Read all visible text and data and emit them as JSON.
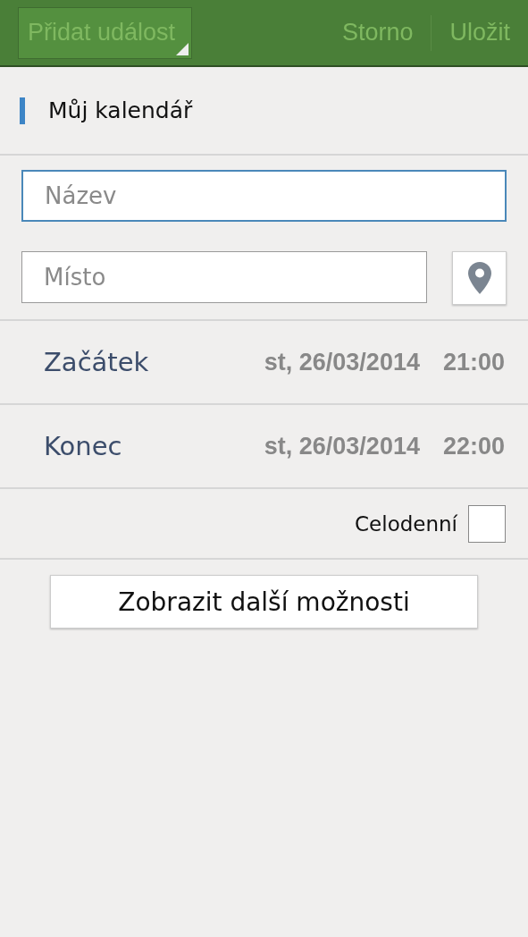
{
  "toolbar": {
    "title": "Přidat událost",
    "actions": [
      "Storno",
      "Uložit"
    ]
  },
  "calendar": {
    "name": "Můj kalendář",
    "color": "#3d85c6"
  },
  "title_field": {
    "placeholder": "Název",
    "focused": true
  },
  "location_field": {
    "placeholder": "Místo"
  },
  "times": [
    {
      "label": "Začátek",
      "date": "st, 26/03/2014",
      "time": "21:00"
    },
    {
      "label": "Konec",
      "date": "st, 26/03/2014",
      "time": "22:00"
    }
  ],
  "all_day": {
    "label": "Celodenní",
    "checked": false
  },
  "more_button": "Zobrazit další možnosti"
}
